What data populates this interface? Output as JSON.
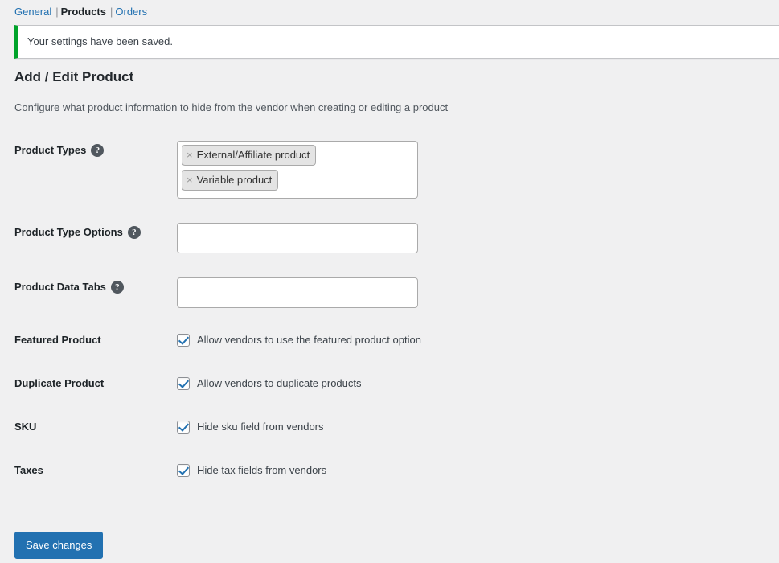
{
  "tabs": {
    "separator": "|",
    "items": [
      {
        "label": "General",
        "active": false
      },
      {
        "label": "Products",
        "active": true
      },
      {
        "label": "Orders",
        "active": false
      }
    ]
  },
  "notice": {
    "message": "Your settings have been saved.",
    "accent_color": "#00a32a"
  },
  "page": {
    "title": "Add / Edit Product",
    "description": "Configure what product information to hide from the vendor when creating or editing a product"
  },
  "help_icon_glyph": "?",
  "fields": {
    "product_types": {
      "label": "Product Types",
      "tags": [
        {
          "remove_glyph": "×",
          "label": "External/Affiliate product"
        },
        {
          "remove_glyph": "×",
          "label": "Variable product"
        }
      ]
    },
    "product_type_options": {
      "label": "Product Type Options",
      "tags": []
    },
    "product_data_tabs": {
      "label": "Product Data Tabs",
      "tags": []
    },
    "featured_product": {
      "label": "Featured Product",
      "checkbox_label": "Allow vendors to use the featured product option",
      "checked": true
    },
    "duplicate_product": {
      "label": "Duplicate Product",
      "checkbox_label": "Allow vendors to duplicate products",
      "checked": true
    },
    "sku": {
      "label": "SKU",
      "checkbox_label": "Hide sku field from vendors",
      "checked": true
    },
    "taxes": {
      "label": "Taxes",
      "checkbox_label": "Hide tax fields from vendors",
      "checked": true
    }
  },
  "submit": {
    "label": "Save changes",
    "color": "#2271b1"
  }
}
